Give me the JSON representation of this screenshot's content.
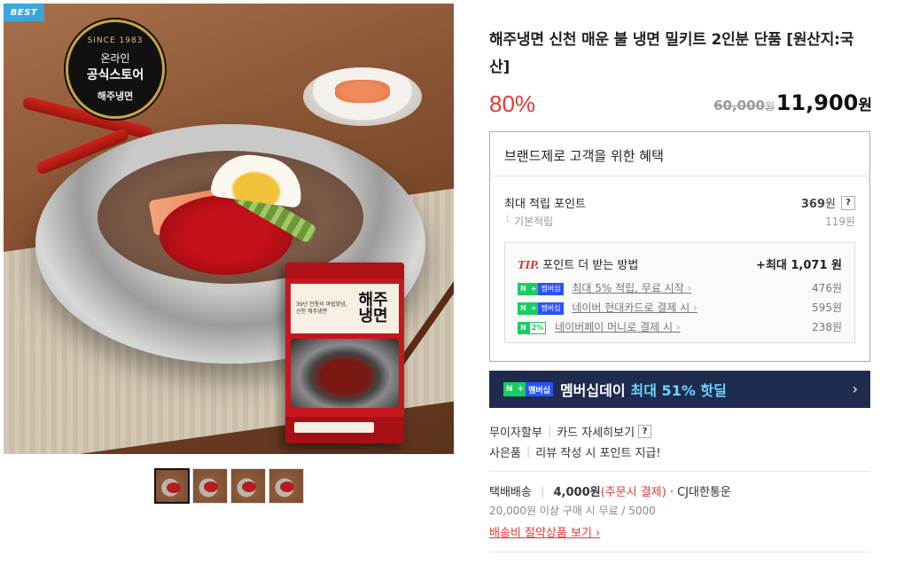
{
  "image": {
    "best_badge": "BEST",
    "seal": {
      "since": "SINCE 1983",
      "line1": "온라인",
      "line2": "공식스토어",
      "brand": "해주냉면"
    },
    "package": {
      "small_text": "39년 전통의 마법양념, 신천 해주냉면",
      "logo": "해주냉면"
    },
    "thumbnails": 4
  },
  "product": {
    "title": "해주냉면 신천 매운 불 냉면 밀키트 2인분 단품 [원산지:국산]",
    "discount": "80%",
    "original_price": "60,000",
    "original_price_unit": "원",
    "sale_price": "11,900",
    "sale_price_unit": "원"
  },
  "benefit": {
    "heading": "브랜드제로 고객을 위한 혜택",
    "max_points_label": "최대 적립 포인트",
    "max_points_value": "369",
    "max_points_unit": "원",
    "help_symbol": "?",
    "base_label": "기본적립",
    "base_value": "119원",
    "tip": {
      "tip_label": "TIP.",
      "title": "포인트 더 받는 방법",
      "max": "+최대 1,071 원",
      "items": [
        {
          "badge": "membership",
          "label": "최대 5% 적립, 무료 시작",
          "value": "476원"
        },
        {
          "badge": "membership",
          "label": "네이버 현대카드로 결제 시",
          "value": "595원"
        },
        {
          "badge": "2%",
          "label": "네이버페이 머니로 결제 시",
          "value": "238원"
        }
      ]
    }
  },
  "badges": {
    "n": "N",
    "plus": "+",
    "membership": "멤버십",
    "two_pct": "2%"
  },
  "membership_bar": {
    "text": "멤버십데이",
    "highlight": "최대 51% 핫딜",
    "arrow": "›"
  },
  "links": {
    "installment": "무이자할부",
    "card_detail": "카드 자세히보기",
    "gift": "사은품",
    "review_points": "리뷰 작성 시 포인트 지급!"
  },
  "shipping": {
    "method": "택배배송",
    "fee": "4,000원",
    "fee_note": "(주문시 결제)",
    "carrier": "· CJ대한통운",
    "free_condition": "20,000원 이상 구매 시 무료 / 5000",
    "saving_link": "배송비 절약상품 보기 ›"
  },
  "colors": {
    "discount": "#e53935",
    "member_bar_bg": "#1e2b4f",
    "member_highlight": "#6bd6ff",
    "naver_green": "#19ce60",
    "best_badge": "#3aa6dc"
  }
}
